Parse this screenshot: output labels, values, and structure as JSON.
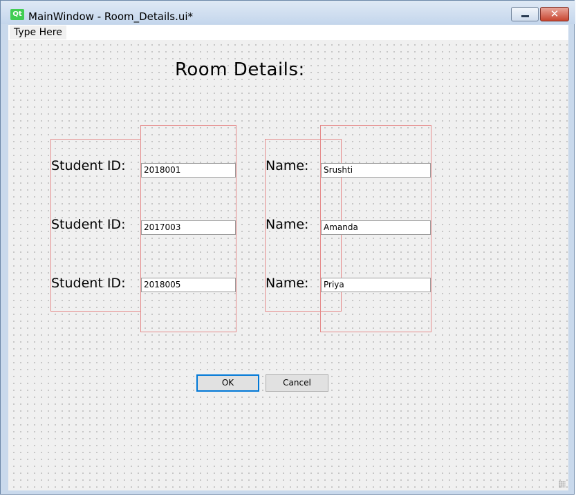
{
  "window": {
    "title": "MainWindow - Room_Details.ui*",
    "app_icon_text": "Qt",
    "close_glyph": "✕"
  },
  "menubar": {
    "placeholder": "Type Here"
  },
  "heading": "Room Details:",
  "rows": [
    {
      "id_label": "Student ID:",
      "id_value": "2018001",
      "name_label": "Name:",
      "name_value": "Srushti"
    },
    {
      "id_label": "Student ID:",
      "id_value": "2017003",
      "name_label": "Name:",
      "name_value": "Amanda"
    },
    {
      "id_label": "Student ID:",
      "id_value": "2018005",
      "name_label": "Name:",
      "name_value": "Priya"
    }
  ],
  "buttons": {
    "ok": "OK",
    "cancel": "Cancel"
  },
  "colors": {
    "layout_outline": "#e58b8b",
    "focus": "#0078d7",
    "qt_green": "#41cd52"
  }
}
